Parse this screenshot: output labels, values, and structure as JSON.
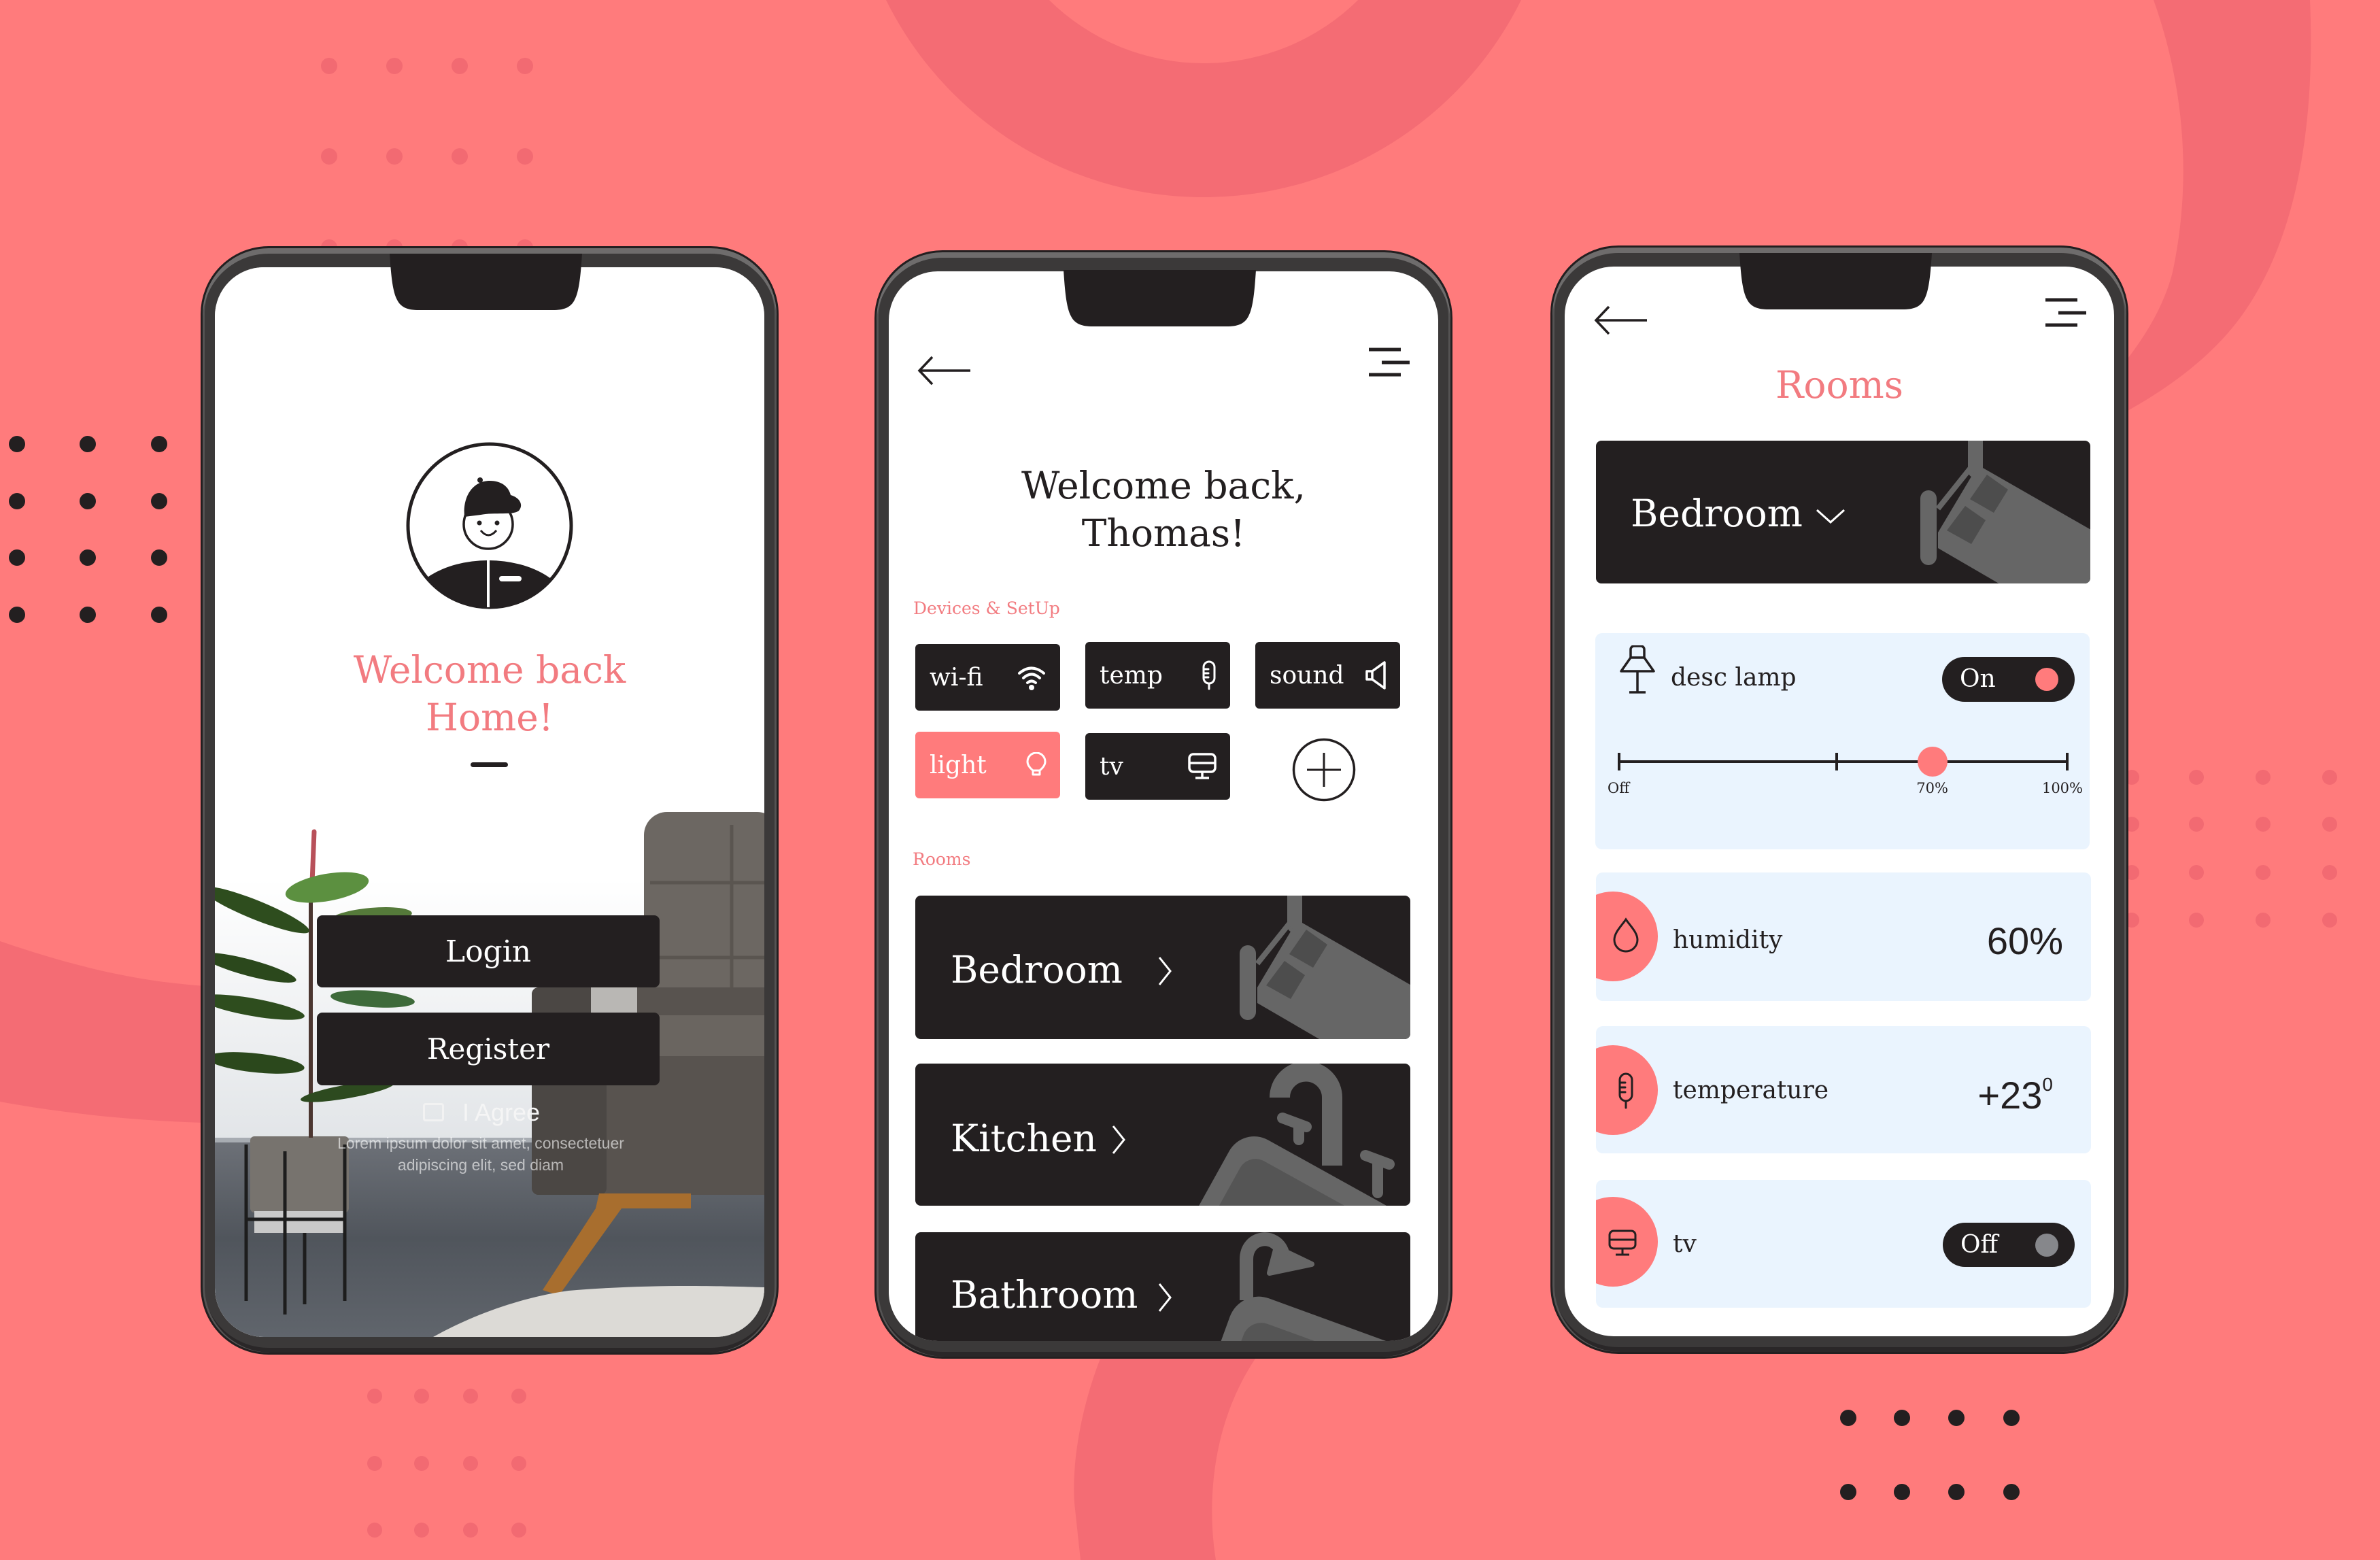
{
  "colors": {
    "background": "#FF7B7C",
    "background_shape": "#F46C74",
    "accent": "#FF7B7C",
    "accent_text": "#F27B80",
    "dark": "#231F20",
    "card_background": "#EAF4FE",
    "illustration_gray": "#666666",
    "toggle_off_knob": "#86878B"
  },
  "screens": {
    "login": {
      "title_line1": "Welcome back",
      "title_line2": "Home!",
      "login_label": "Login",
      "register_label": "Register",
      "agree_label": "I Agree",
      "agree_checked": false,
      "disclaimer_line1": "Lorem ipsum dolor sit amet, consectetuer",
      "disclaimer_line2": "adipiscing elit, sed diam"
    },
    "home": {
      "greeting_line1": "Welcome back,",
      "greeting_line2": "Thomas!",
      "devices_label": "Devices & SetUp",
      "devices": [
        {
          "label": "wi-fi",
          "icon": "wifi-icon",
          "active": false
        },
        {
          "label": "temp",
          "icon": "thermometer-icon",
          "active": false
        },
        {
          "label": "sound",
          "icon": "speaker-icon",
          "active": false
        },
        {
          "label": "light",
          "icon": "bulb-icon",
          "active": true
        },
        {
          "label": "tv",
          "icon": "monitor-icon",
          "active": false
        }
      ],
      "add_device_icon": "plus-circle-icon",
      "rooms_label": "Rooms",
      "rooms": [
        {
          "name": "Bedroom",
          "illustration": "bed"
        },
        {
          "name": "Kitchen",
          "illustration": "sink"
        },
        {
          "name": "Bathroom",
          "illustration": "bathtub"
        }
      ]
    },
    "room_detail": {
      "title": "Rooms",
      "selected_room": "Bedroom",
      "lamp": {
        "name": "desc lamp",
        "state": "On",
        "brightness_percent": 70,
        "scale_min_label": "Off",
        "scale_current_label": "70%",
        "scale_max_label": "100%"
      },
      "sensors": [
        {
          "name": "humidity",
          "value": "60%",
          "icon": "drop-icon"
        },
        {
          "name": "temperature",
          "value": "+23",
          "value_superscript": "0",
          "icon": "thermometer-icon"
        }
      ],
      "tv": {
        "name": "tv",
        "state": "Off",
        "icon": "monitor-icon"
      }
    }
  }
}
